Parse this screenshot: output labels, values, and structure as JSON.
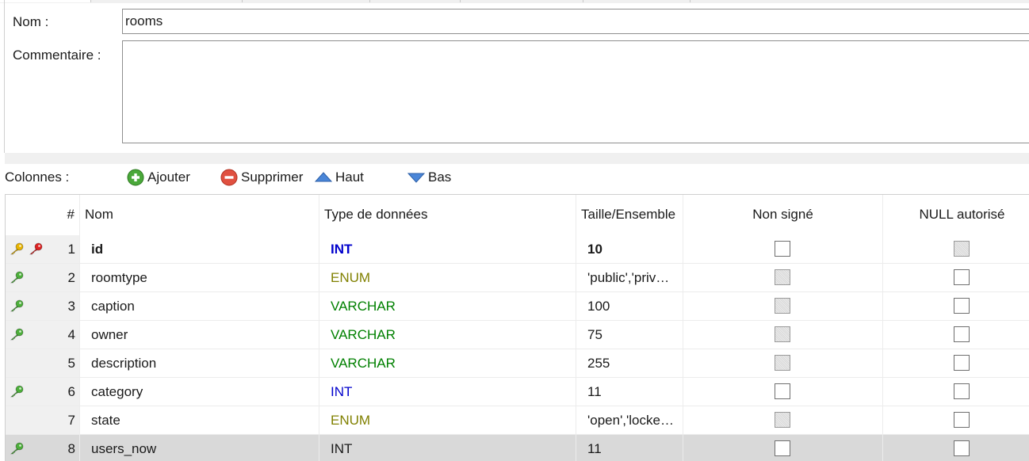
{
  "form": {
    "name_label": "Nom :",
    "name_value": "rooms",
    "comment_label": "Commentaire :",
    "comment_value": ""
  },
  "toolbar": {
    "label": "Colonnes :",
    "add": "Ajouter",
    "delete": "Supprimer",
    "up": "Haut",
    "down": "Bas"
  },
  "columns_header": {
    "num": "#",
    "name": "Nom",
    "type": "Type de données",
    "size": "Taille/Ensemble",
    "unsigned": "Non signé",
    "nullable": "NULL autorisé"
  },
  "colors": {
    "type_int": "#0000cc",
    "type_string": "#008000",
    "type_enum": "#808000",
    "key_primary": "#e8b400",
    "key_foreign": "#dd2222",
    "key_index": "#4caf3a",
    "selected_row": "#d9d9d9"
  },
  "rows": [
    {
      "num": "1",
      "name": "id",
      "type": "INT",
      "type_color": "int",
      "size": "10",
      "unsigned_disabled": false,
      "null_disabled": true,
      "keys": [
        "primary",
        "foreign"
      ],
      "bold": true,
      "selected": false
    },
    {
      "num": "2",
      "name": "roomtype",
      "type": "ENUM",
      "type_color": "enum",
      "size": "'public','priv…",
      "unsigned_disabled": true,
      "null_disabled": false,
      "keys": [
        "index"
      ],
      "bold": false,
      "selected": false
    },
    {
      "num": "3",
      "name": "caption",
      "type": "VARCHAR",
      "type_color": "string",
      "size": "100",
      "unsigned_disabled": true,
      "null_disabled": false,
      "keys": [
        "index"
      ],
      "bold": false,
      "selected": false
    },
    {
      "num": "4",
      "name": "owner",
      "type": "VARCHAR",
      "type_color": "string",
      "size": "75",
      "unsigned_disabled": true,
      "null_disabled": false,
      "keys": [
        "index"
      ],
      "bold": false,
      "selected": false
    },
    {
      "num": "5",
      "name": "description",
      "type": "VARCHAR",
      "type_color": "string",
      "size": "255",
      "unsigned_disabled": true,
      "null_disabled": false,
      "keys": [],
      "bold": false,
      "selected": false
    },
    {
      "num": "6",
      "name": "category",
      "type": "INT",
      "type_color": "int",
      "size": "11",
      "unsigned_disabled": false,
      "null_disabled": false,
      "keys": [
        "index"
      ],
      "bold": false,
      "selected": false
    },
    {
      "num": "7",
      "name": "state",
      "type": "ENUM",
      "type_color": "enum",
      "size": "'open','locke…",
      "unsigned_disabled": true,
      "null_disabled": false,
      "keys": [],
      "bold": false,
      "selected": false
    },
    {
      "num": "8",
      "name": "users_now",
      "type": "INT",
      "type_color": "plain",
      "size": "11",
      "unsigned_disabled": false,
      "null_disabled": false,
      "keys": [
        "index"
      ],
      "bold": false,
      "selected": true
    }
  ]
}
